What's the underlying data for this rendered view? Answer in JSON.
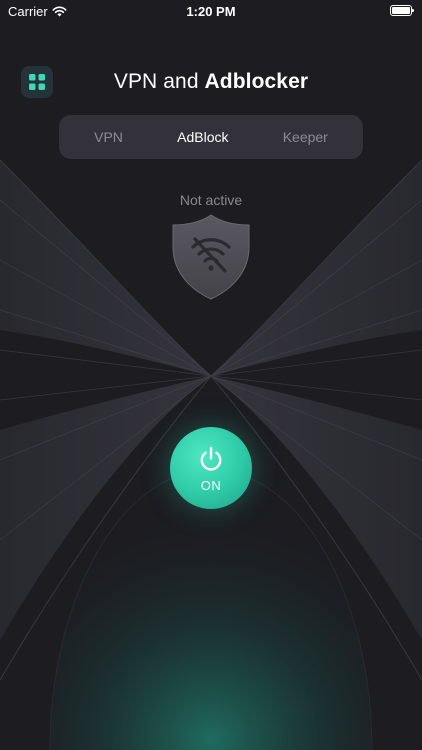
{
  "status_bar": {
    "carrier": "Carrier",
    "time": "1:20 PM"
  },
  "header": {
    "title_light": "VPN and",
    "title_bold": "Adblocker",
    "menu_icon": "grid-icon"
  },
  "tabs": [
    {
      "label": "VPN",
      "active": false
    },
    {
      "label": "AdBlock",
      "active": true
    },
    {
      "label": "Keeper",
      "active": false
    }
  ],
  "status": {
    "text": "Not active",
    "icon": "shield-wifi-off-icon"
  },
  "power": {
    "label": "ON",
    "icon": "power-icon"
  },
  "colors": {
    "background": "#1c1c21",
    "accent": "#2ec9a6",
    "tab_bar": "#33323b",
    "menu_button": "#24323a"
  }
}
